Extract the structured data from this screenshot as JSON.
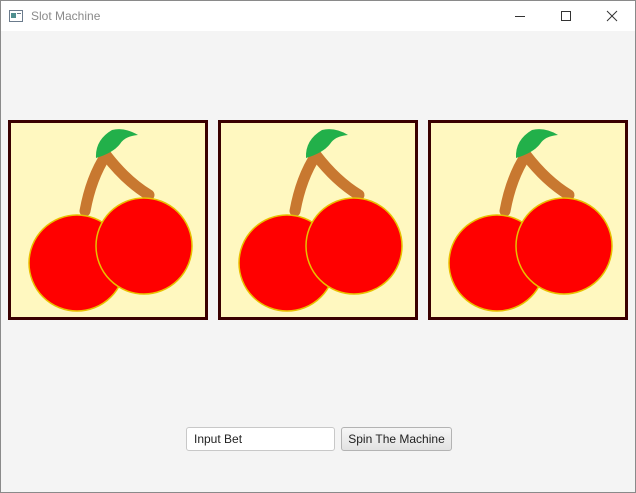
{
  "window": {
    "title": "Slot Machine",
    "controls": [
      "minimize",
      "maximize",
      "close"
    ]
  },
  "reels": [
    {
      "symbol": "cherry",
      "icon": "cherry-icon"
    },
    {
      "symbol": "cherry",
      "icon": "cherry-icon"
    },
    {
      "symbol": "cherry",
      "icon": "cherry-icon"
    }
  ],
  "controls": {
    "bet_input_value": "Input Bet",
    "spin_label": "Spin The Machine"
  },
  "colors": {
    "reel_background": "#fff8c0",
    "reel_border": "#3a0000",
    "cherry_red": "#ff0000",
    "cherry_outline": "#e8c000",
    "stem": "#c87830",
    "leaf": "#22b04a",
    "window_background": "#f4f4f4"
  }
}
